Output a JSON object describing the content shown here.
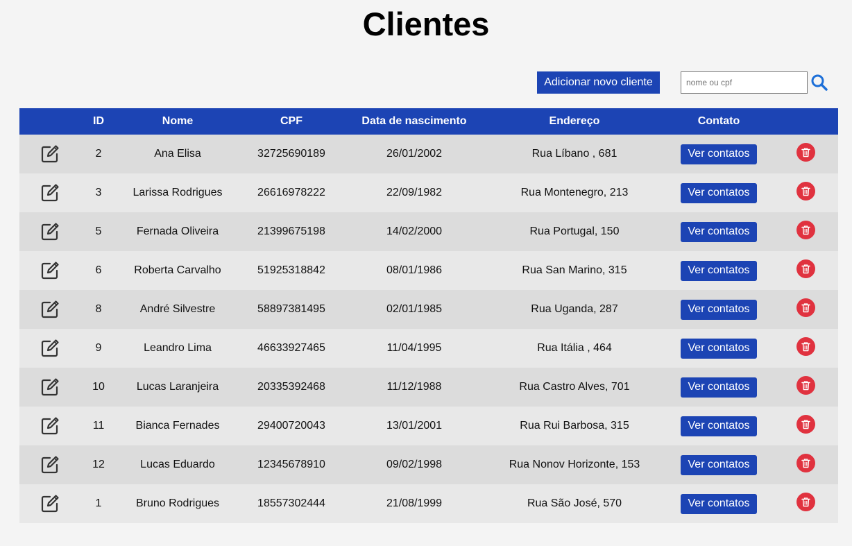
{
  "page": {
    "title": "Clientes"
  },
  "toolbar": {
    "add_label": "Adicionar novo cliente",
    "search_placeholder": "nome ou cpf",
    "search_value": "",
    "search_icon": "search-icon"
  },
  "table": {
    "columns": [
      "",
      "ID",
      "Nome",
      "CPF",
      "Data de nascimento",
      "Endereço",
      "Contato",
      ""
    ],
    "contact_button_label": "Ver contatos",
    "row_icons": {
      "edit": "edit-icon",
      "delete": "trash-icon"
    },
    "rows": [
      {
        "id": "2",
        "nome": "Ana Elisa",
        "cpf": "32725690189",
        "nascimento": "26/01/2002",
        "endereco": "Rua Líbano , 681"
      },
      {
        "id": "3",
        "nome": "Larissa Rodrigues",
        "cpf": "26616978222",
        "nascimento": "22/09/1982",
        "endereco": "Rua Montenegro, 213"
      },
      {
        "id": "5",
        "nome": "Fernada Oliveira",
        "cpf": "21399675198",
        "nascimento": "14/02/2000",
        "endereco": "Rua Portugal, 150"
      },
      {
        "id": "6",
        "nome": "Roberta Carvalho",
        "cpf": "51925318842",
        "nascimento": "08/01/1986",
        "endereco": "Rua San Marino, 315"
      },
      {
        "id": "8",
        "nome": "André Silvestre",
        "cpf": "58897381495",
        "nascimento": "02/01/1985",
        "endereco": "Rua Uganda, 287"
      },
      {
        "id": "9",
        "nome": "Leandro Lima",
        "cpf": "46633927465",
        "nascimento": "11/04/1995",
        "endereco": "Rua Itália , 464"
      },
      {
        "id": "10",
        "nome": "Lucas Laranjeira",
        "cpf": "20335392468",
        "nascimento": "11/12/1988",
        "endereco": "Rua Castro Alves, 701"
      },
      {
        "id": "11",
        "nome": "Bianca Fernades",
        "cpf": "29400720043",
        "nascimento": "13/01/2001",
        "endereco": "Rua Rui Barbosa, 315"
      },
      {
        "id": "12",
        "nome": "Lucas Eduardo",
        "cpf": "12345678910",
        "nascimento": "09/02/1998",
        "endereco": "Rua Nonov Horizonte, 153"
      },
      {
        "id": "1",
        "nome": "Bruno Rodrigues",
        "cpf": "18557302444",
        "nascimento": "21/08/1999",
        "endereco": "Rua São José, 570"
      }
    ]
  },
  "colors": {
    "background": "#f4f4f4",
    "accent": "#1c44b4",
    "row_odd": "#dcdcdc",
    "row_even": "#e8e8e8",
    "delete": "#e0323f"
  }
}
